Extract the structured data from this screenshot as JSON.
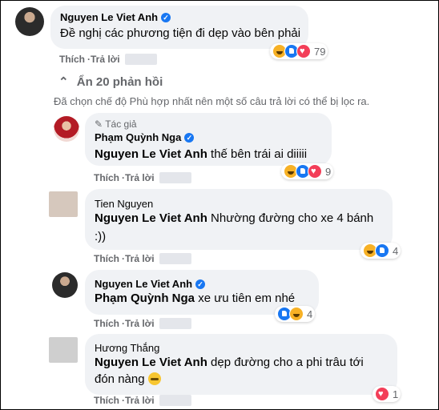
{
  "comments": [
    {
      "name": "Nguyen Le Viet Anh",
      "text": "Đề nghị các phương tiện đi dẹp vào bên phải",
      "like": "Thích",
      "reply": "Trả lời",
      "reactions": [
        "haha-icon",
        "like-icon",
        "love-icon"
      ],
      "count": "79"
    },
    {
      "author_badge": "Tác giả",
      "name": "Phạm Quỳnh Nga",
      "tag": "Nguyen Le Viet Anh",
      "text": " thế bên trái ai diiiii",
      "like": "Thích",
      "reply": "Trả lời",
      "count": "9"
    },
    {
      "name": "Tien Nguyen",
      "tag": "Nguyen Le Viet Anh",
      "text": " Nhường đường cho xe 4 bánh",
      "text2": ":))",
      "like": "Thích",
      "reply": "Trả lời",
      "count": "4"
    },
    {
      "name": "Nguyen Le Viet Anh",
      "tag": "Phạm Quỳnh Nga",
      "text": " xe ưu tiên em nhé",
      "like": "Thích",
      "reply": "Trả lời",
      "count": "4"
    },
    {
      "name": "Hương Thắng",
      "tag": "Nguyen Le Viet Anh",
      "text": " dẹp đường cho a phi trâu tới",
      "text2": "đón nàng",
      "like": "Thích",
      "reply": "Trả lời",
      "count": "1"
    }
  ],
  "hide_replies": "Ẩn 20 phản hồi",
  "notice": "Đã chọn chế độ Phù hợp nhất nên một số câu trả lời có thể bị lọc ra.",
  "dot": "·",
  "verified": "✓",
  "colors": {
    "bubble": "#f0f2f5",
    "link_blue": "#1877f2",
    "muted": "#65676b"
  }
}
